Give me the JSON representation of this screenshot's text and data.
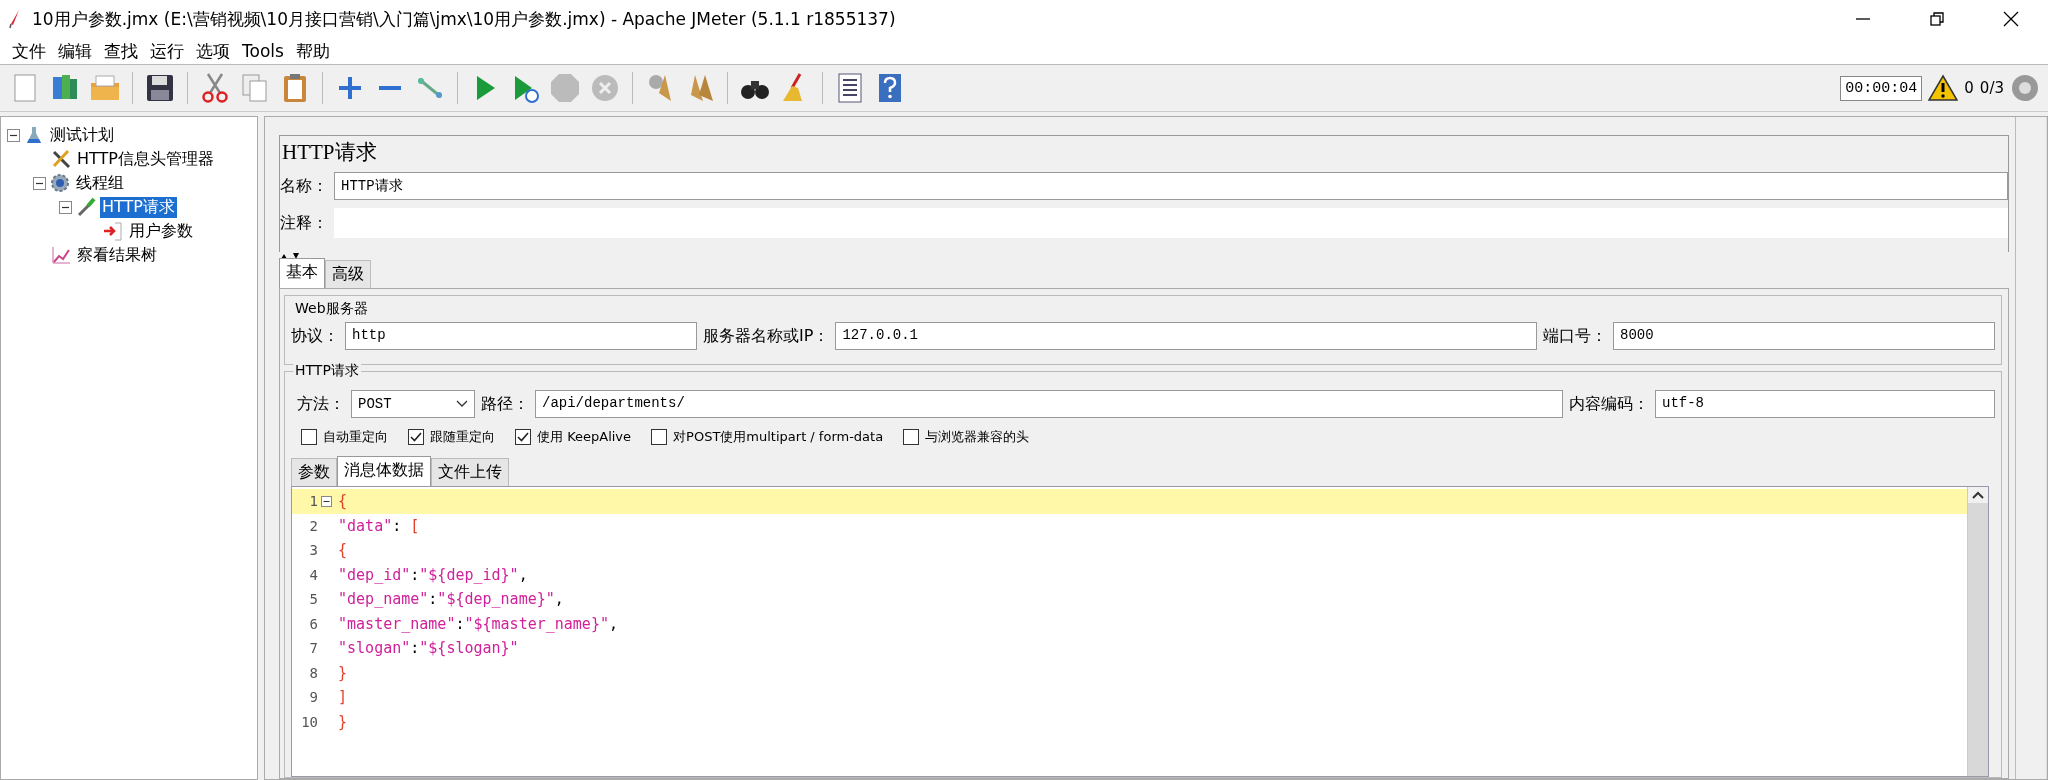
{
  "window": {
    "title": "10用户参数.jmx (E:\\营销视频\\10月接口营销\\入门篇\\jmx\\10用户参数.jmx) - Apache JMeter (5.1.1 r1855137)"
  },
  "menu": [
    "文件",
    "编辑",
    "查找",
    "运行",
    "选项",
    "Tools",
    "帮助"
  ],
  "toolbar": {
    "timer": "00:00:04",
    "warnings": "0",
    "threads": "0/3"
  },
  "tree": [
    {
      "label": "测试计划",
      "kind": "plan",
      "selected": false,
      "expanded": true,
      "children": [
        {
          "label": "HTTP信息头管理器",
          "kind": "header",
          "selected": false
        },
        {
          "label": "线程组",
          "kind": "threads",
          "selected": false,
          "expanded": true,
          "children": [
            {
              "label": "HTTP请求",
              "kind": "sampler",
              "selected": true,
              "expanded": true,
              "children": [
                {
                  "label": "用户参数",
                  "kind": "preprocessor",
                  "selected": false
                }
              ]
            }
          ]
        },
        {
          "label": "察看结果树",
          "kind": "listener",
          "selected": false
        }
      ]
    }
  ],
  "panel": {
    "title": "HTTP请求",
    "name_label": "名称：",
    "name_value": "HTTP请求",
    "comment_label": "注释：",
    "tabs": [
      {
        "label": "基本",
        "selected": true
      },
      {
        "label": "高级",
        "selected": false
      }
    ],
    "web_server": {
      "legend": "Web服务器",
      "protocol_label": "协议：",
      "protocol": "http",
      "server_label": "服务器名称或IP：",
      "server": "127.0.0.1",
      "port_label": "端口号：",
      "port": "8000"
    },
    "http_request": {
      "legend": "HTTP请求",
      "method_label": "方法：",
      "method": "POST",
      "path_label": "路径：",
      "path": "/api/departments/",
      "encoding_label": "内容编码：",
      "encoding": "utf-8",
      "options": [
        {
          "label": "自动重定向",
          "checked": false
        },
        {
          "label": "跟随重定向",
          "checked": true
        },
        {
          "label": "使用 KeepAlive",
          "checked": true
        },
        {
          "label": "对POST使用multipart / form-data",
          "checked": false
        },
        {
          "label": "与浏览器兼容的头",
          "checked": false
        }
      ],
      "body_tabs": [
        {
          "label": "参数",
          "selected": false
        },
        {
          "label": "消息体数据",
          "selected": true
        },
        {
          "label": "文件上传",
          "selected": false
        }
      ],
      "editor": {
        "lines": [
          {
            "number": "1",
            "text": "{",
            "current": true,
            "foldable": true
          },
          {
            "number": "2",
            "text": "\"data\": [",
            "current": false,
            "foldable": false
          },
          {
            "number": "3",
            "text": "{",
            "current": false,
            "foldable": false
          },
          {
            "number": "4",
            "text": "\"dep_id\":\"${dep_id}\",",
            "current": false,
            "foldable": false
          },
          {
            "number": "5",
            "text": "\"dep_name\":\"${dep_name}\",",
            "current": false,
            "foldable": false
          },
          {
            "number": "6",
            "text": "\"master_name\":\"${master_name}\",",
            "current": false,
            "foldable": false
          },
          {
            "number": "7",
            "text": "\"slogan\":\"${slogan}\"",
            "current": false,
            "foldable": false
          },
          {
            "number": "8",
            "text": "}",
            "current": false,
            "foldable": false
          },
          {
            "number": "9",
            "text": "]",
            "current": false,
            "foldable": false
          },
          {
            "number": "10",
            "text": "}",
            "current": false,
            "foldable": false
          }
        ]
      }
    }
  }
}
